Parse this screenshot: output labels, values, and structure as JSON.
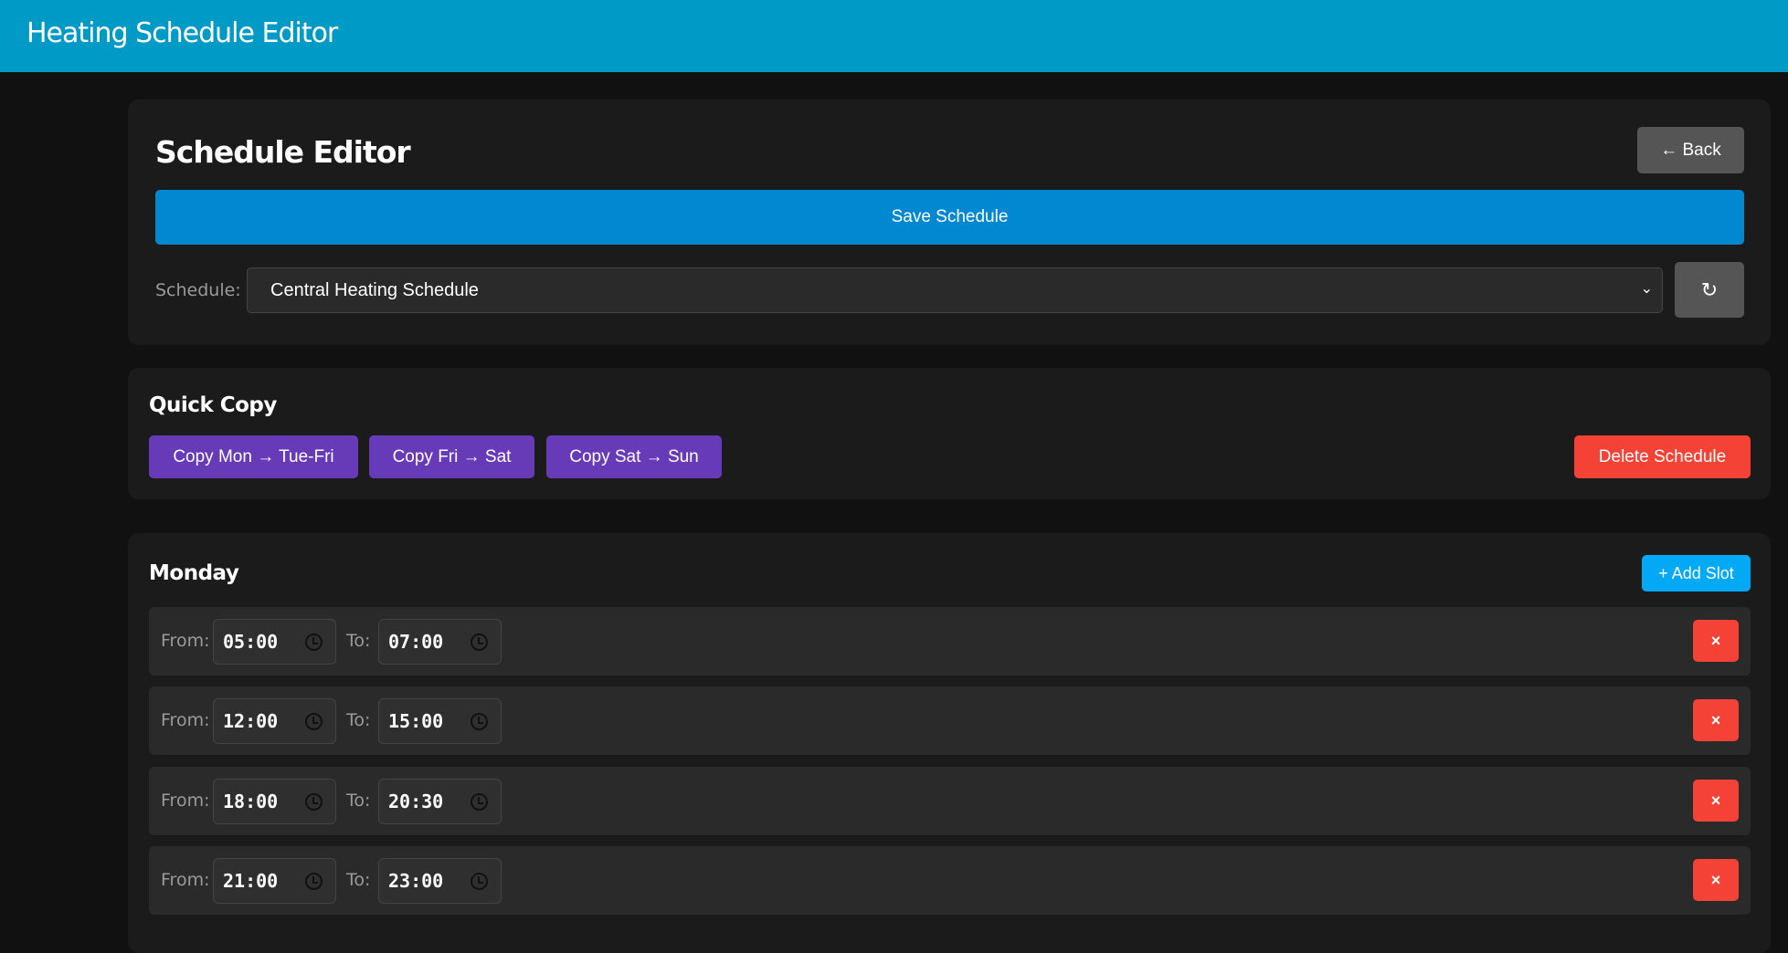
{
  "header": {
    "title": "Heating Schedule Editor"
  },
  "editor": {
    "title": "Schedule Editor",
    "back_label": "← Back",
    "save_label": "Save Schedule",
    "schedule_label": "Schedule:",
    "schedule_value": "Central Heating Schedule",
    "refresh_label": "↻"
  },
  "quick_copy": {
    "title": "Quick Copy",
    "buttons": [
      {
        "label": "Copy Mon → Tue-Fri"
      },
      {
        "label": "Copy Fri → Sat"
      },
      {
        "label": "Copy Sat → Sun"
      }
    ],
    "delete_label": "Delete Schedule"
  },
  "day": {
    "title": "Monday",
    "add_label": "+ Add Slot",
    "from_label": "From:",
    "to_label": "To:",
    "remove_label": "×",
    "slots": [
      {
        "from": "05:00",
        "to": "07:00"
      },
      {
        "from": "12:00",
        "to": "15:00"
      },
      {
        "from": "18:00",
        "to": "20:30"
      },
      {
        "from": "21:00",
        "to": "23:00"
      }
    ]
  },
  "colors": {
    "header": "#009ac7",
    "save": "#0288d1",
    "copy": "#673ab7",
    "delete": "#f44336",
    "add": "#03a9f4"
  }
}
